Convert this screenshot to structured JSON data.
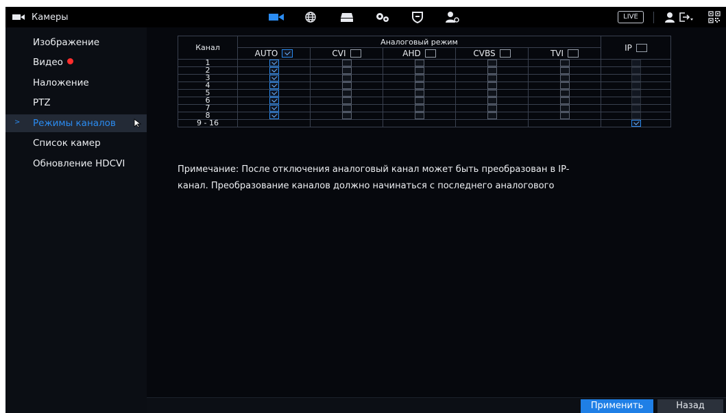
{
  "header": {
    "title": "Камеры",
    "title_icon": "camera-icon",
    "live_label": "LIVE",
    "accent_color": "#2b8cf2",
    "nav_icons": [
      "camera-icon",
      "network-globe-icon",
      "storage-icon",
      "settings-gears-icon",
      "security-shield-icon",
      "account-settings-icon"
    ],
    "right_icons": [
      "user-icon",
      "logout-icon",
      "qr-code-icon"
    ]
  },
  "sidebar": {
    "items": [
      {
        "label": "Изображение"
      },
      {
        "label": "Видео"
      },
      {
        "label": "Наложение"
      },
      {
        "label": "PTZ"
      },
      {
        "label": "Режимы каналов"
      },
      {
        "label": "Список камер"
      },
      {
        "label": "Обновление HDCVI"
      }
    ],
    "active_index": 4,
    "badge_on": "Видео",
    "selected_marker": ">"
  },
  "table": {
    "channel_header": "Канал",
    "analog_header": "Аналоговый режим",
    "ip_header": "IP",
    "modes": [
      "AUTO",
      "CVI",
      "AHD",
      "CVBS",
      "TVI"
    ],
    "header_checked": {
      "AUTO": true,
      "CVI": false,
      "AHD": false,
      "CVBS": false,
      "TVI": false,
      "IP": false
    },
    "rows": [
      {
        "channel": "1",
        "AUTO": true,
        "CVI": false,
        "AHD": false,
        "CVBS": false,
        "TVI": false,
        "IP": false
      },
      {
        "channel": "2",
        "AUTO": true,
        "CVI": false,
        "AHD": false,
        "CVBS": false,
        "TVI": false,
        "IP": false
      },
      {
        "channel": "3",
        "AUTO": true,
        "CVI": false,
        "AHD": false,
        "CVBS": false,
        "TVI": false,
        "IP": false
      },
      {
        "channel": "4",
        "AUTO": true,
        "CVI": false,
        "AHD": false,
        "CVBS": false,
        "TVI": false,
        "IP": false
      },
      {
        "channel": "5",
        "AUTO": true,
        "CVI": false,
        "AHD": false,
        "CVBS": false,
        "TVI": false,
        "IP": false
      },
      {
        "channel": "6",
        "AUTO": true,
        "CVI": false,
        "AHD": false,
        "CVBS": false,
        "TVI": false,
        "IP": false
      },
      {
        "channel": "7",
        "AUTO": true,
        "CVI": false,
        "AHD": false,
        "CVBS": false,
        "TVI": false,
        "IP": false
      },
      {
        "channel": "8",
        "AUTO": true,
        "CVI": false,
        "AHD": false,
        "CVBS": false,
        "TVI": false,
        "IP": false
      },
      {
        "channel": "9 - 16",
        "analog_enabled": false,
        "IP": true
      }
    ]
  },
  "note": {
    "line1": "Примечание: После отключения аналоговый канал может быть преобразован в IP-",
    "line2": "канал. Преобразование каналов должно начинаться с последнего аналогового"
  },
  "footer": {
    "apply_label": "Применить",
    "back_label": "Назад"
  }
}
